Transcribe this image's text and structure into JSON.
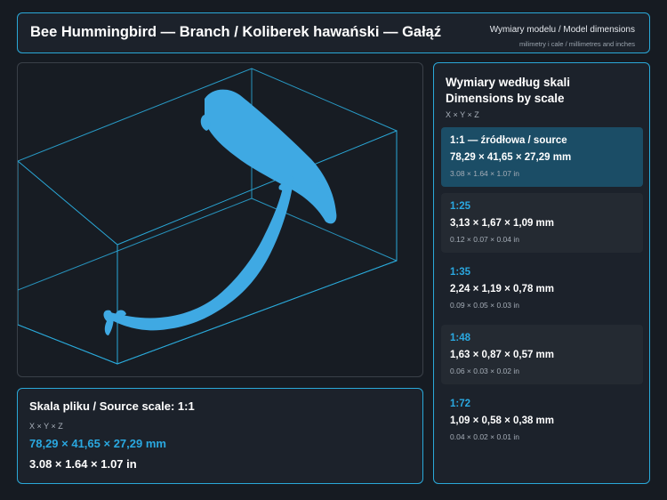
{
  "header": {
    "title": "Bee Hummingbird — Branch / Koliberek hawański — Gałąź",
    "dims_label": "Wymiary modelu / Model dimensions",
    "dims_sub": "milimetry i cale / millimetres and inches"
  },
  "source": {
    "title": "Skala pliku / Source scale: 1:1",
    "xyz": "X × Y × Z",
    "mm": "78,29 × 41,65 × 27,29 mm",
    "inches": "3.08 × 1.64 × 1.07 in"
  },
  "scales": {
    "title_line1": "Wymiary według skali",
    "title_line2": "Dimensions by scale",
    "xyz": "X × Y × Z",
    "items": [
      {
        "name": "1:1  —  źródłowa / source",
        "mm": "78,29 × 41,65 × 27,29 mm",
        "inches": "3.08 × 1.64 × 1.07 in"
      },
      {
        "name": "1:25",
        "mm": "3,13 × 1,67 × 1,09 mm",
        "inches": "0.12 × 0.07 × 0.04 in"
      },
      {
        "name": "1:35",
        "mm": "2,24 × 1,19 × 0,78 mm",
        "inches": "0.09 × 0.05 × 0.03 in"
      },
      {
        "name": "1:48",
        "mm": "1,63 × 0,87 × 0,57 mm",
        "inches": "0.06 × 0.03 × 0.02 in"
      },
      {
        "name": "1:72",
        "mm": "1,09 × 0,58 × 0,38 mm",
        "inches": "0.04 × 0.02 × 0.01 in"
      }
    ]
  },
  "colors": {
    "accent": "#2aa8e0",
    "model": "#3fa9e3",
    "bounding_box": "#2aa8d8",
    "active_card": "#1b4d66",
    "background": "#161b22"
  }
}
